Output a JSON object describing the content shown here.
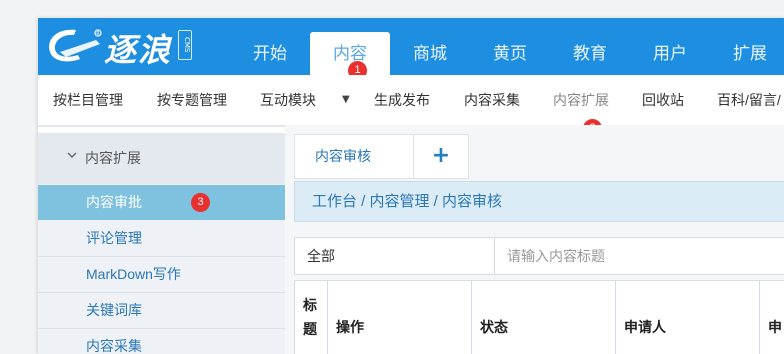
{
  "app": {
    "logo_text": "逐浪",
    "logo_sub": "CMS"
  },
  "header": {
    "tabs": [
      {
        "label": "开始"
      },
      {
        "label": "内容",
        "active": true
      },
      {
        "label": "商城"
      },
      {
        "label": "黄页"
      },
      {
        "label": "教育"
      },
      {
        "label": "用户"
      },
      {
        "label": "扩展"
      }
    ],
    "badges": [
      "1",
      "2",
      "3"
    ]
  },
  "subnav": {
    "items": [
      "按栏目管理",
      "按专题管理",
      "互动模块",
      "生成发布",
      "内容采集",
      "内容扩展",
      "回收站",
      "百科/留言/"
    ]
  },
  "sidebar": {
    "group_label": "内容扩展",
    "items": [
      "内容审批",
      "评论管理",
      "MarkDown写作",
      "关键词库",
      "内容采集"
    ]
  },
  "main": {
    "page_tab": "内容审核",
    "add_tab": "+",
    "breadcrumb": "工作台 / 内容管理 / 内容审核",
    "filter": {
      "selected": "全部",
      "placeholder": "请输入内容标题"
    },
    "table": {
      "headers": [
        "标题",
        "操作",
        "状态",
        "申请人",
        "申"
      ]
    }
  },
  "colors": {
    "header_blue": "#1e8fe0",
    "sidebar_active": "#7ec2e0",
    "badge_red": "#e8312f",
    "link_blue": "#2a77b8"
  }
}
